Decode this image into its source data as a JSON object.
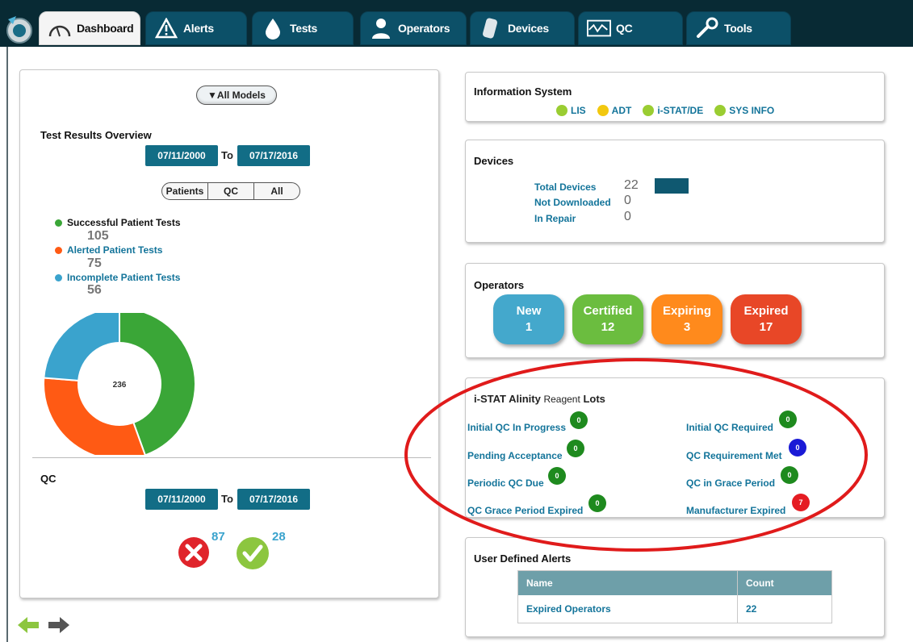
{
  "tabs": [
    {
      "label": "Dashboard",
      "icon": "gauge-icon",
      "active": true
    },
    {
      "label": "Alerts",
      "icon": "warning-icon"
    },
    {
      "label": "Tests",
      "icon": "drop-icon"
    },
    {
      "label": "Operators",
      "icon": "user-icon"
    },
    {
      "label": "Devices",
      "icon": "device-icon"
    },
    {
      "label": "QC",
      "icon": "waveform-icon"
    },
    {
      "label": "Tools",
      "icon": "wrench-icon"
    }
  ],
  "left": {
    "models_button": "▼All Models",
    "overview_title": "Test Results Overview",
    "date_from": "07/11/2000",
    "date_to": "07/17/2016",
    "to_label": "To",
    "segment": [
      "Patients",
      "QC",
      "All"
    ],
    "legend": [
      {
        "label": "Successful Patient Tests",
        "value": "105",
        "color": "#3aa637"
      },
      {
        "label": "Alerted Patient Tests",
        "value": "75",
        "color": "#ff5a14"
      },
      {
        "label": "Incomplete Patient Tests",
        "value": "56",
        "color": "#3aa3cd"
      }
    ],
    "donut_total": "236",
    "qc_title": "QC",
    "qc_date_from": "07/11/2000",
    "qc_date_to": "07/17/2016",
    "qc_fail_count": "87",
    "qc_pass_count": "28"
  },
  "chart_data": {
    "type": "pie",
    "categories": [
      "Successful Patient Tests",
      "Alerted Patient Tests",
      "Incomplete Patient Tests"
    ],
    "values": [
      105,
      75,
      56
    ],
    "colors": [
      "#3aa637",
      "#ff5a14",
      "#3aa3cd"
    ],
    "center_label": "236"
  },
  "info_system": {
    "title": "Information System",
    "items": [
      {
        "label": "LIS",
        "color": "#9acd32"
      },
      {
        "label": "ADT",
        "color": "#f2c80f"
      },
      {
        "label": "i-STAT/DE",
        "color": "#9acd32"
      },
      {
        "label": "SYS INFO",
        "color": "#9acd32"
      }
    ]
  },
  "devices": {
    "title": "Devices",
    "rows": [
      {
        "label": "Total Devices",
        "value": "22"
      },
      {
        "label": "Not Downloaded",
        "value": "0"
      },
      {
        "label": "In Repair",
        "value": "0"
      }
    ]
  },
  "operators": {
    "title": "Operators",
    "buttons": [
      {
        "label": "New",
        "value": "1",
        "color": "#44a8cc"
      },
      {
        "label": "Certified",
        "value": "12",
        "color": "#6bbd3f"
      },
      {
        "label": "Expiring",
        "value": "3",
        "color": "#ff8a1c"
      },
      {
        "label": "Expired",
        "value": "17",
        "color": "#e84727"
      }
    ]
  },
  "reagent": {
    "title_bold": "i-STAT Alinity",
    "title_mid": "Reagent",
    "title_end": "Lots",
    "left": [
      {
        "label": "Initial QC In Progress",
        "count": "0",
        "color": "#1e8a1e"
      },
      {
        "label": "Pending Acceptance",
        "count": "0",
        "color": "#1e8a1e"
      },
      {
        "label": "Periodic QC Due",
        "count": "0",
        "color": "#1e8a1e"
      },
      {
        "label": "QC Grace Period Expired",
        "count": "0",
        "color": "#1e8a1e"
      }
    ],
    "right": [
      {
        "label": "Initial QC Required",
        "count": "0",
        "color": "#1e8a1e"
      },
      {
        "label": "QC Requirement Met",
        "count": "0",
        "color": "#1a1ad6"
      },
      {
        "label": "QC in Grace Period",
        "count": "0",
        "color": "#1e8a1e"
      },
      {
        "label": "Manufacturer Expired",
        "count": "7",
        "color": "#e51c23"
      }
    ]
  },
  "user_alerts": {
    "title": "User Defined Alerts",
    "columns": [
      "Name",
      "Count"
    ],
    "rows": [
      {
        "name": "Expired Operators",
        "count": "22"
      }
    ]
  }
}
